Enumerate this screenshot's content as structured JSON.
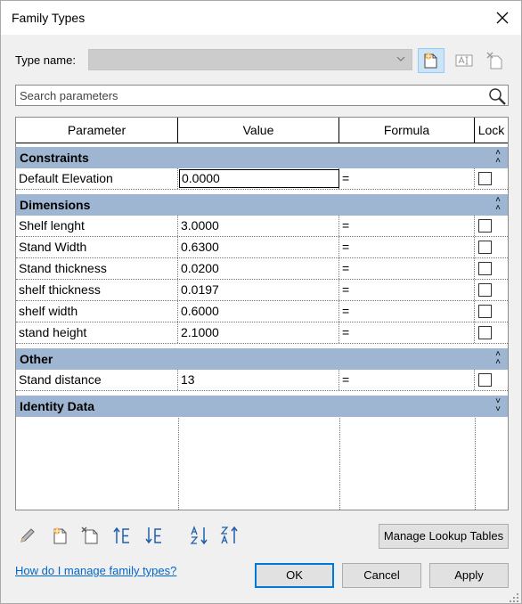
{
  "window": {
    "title": "Family Types"
  },
  "type_name": {
    "label": "Type name:",
    "value": ""
  },
  "search": {
    "placeholder": "Search parameters"
  },
  "table": {
    "headers": {
      "parameter": "Parameter",
      "value": "Value",
      "formula": "Formula",
      "lock": "Lock"
    },
    "groups": [
      {
        "title": "Constraints",
        "rows": [
          {
            "parameter": "Default Elevation",
            "value": "0.0000",
            "formula": "=",
            "locked": false
          }
        ]
      },
      {
        "title": "Dimensions",
        "rows": [
          {
            "parameter": "Shelf lenght",
            "value": "3.0000",
            "formula": "=",
            "locked": false
          },
          {
            "parameter": "Stand Width",
            "value": "0.6300",
            "formula": "=",
            "locked": false
          },
          {
            "parameter": "Stand thickness",
            "value": "0.0200",
            "formula": "=",
            "locked": false
          },
          {
            "parameter": "shelf thickness",
            "value": "0.0197",
            "formula": "=",
            "locked": false
          },
          {
            "parameter": "shelf width",
            "value": "0.6000",
            "formula": "=",
            "locked": false
          },
          {
            "parameter": "stand height",
            "value": "2.1000",
            "formula": "=",
            "locked": false
          }
        ]
      },
      {
        "title": "Other",
        "rows": [
          {
            "parameter": "Stand distance",
            "value": "13",
            "formula": "=",
            "locked": false
          }
        ]
      },
      {
        "title": "Identity Data",
        "rows": []
      }
    ]
  },
  "buttons": {
    "manage_lookup": "Manage Lookup Tables",
    "ok": "OK",
    "cancel": "Cancel",
    "apply": "Apply"
  },
  "help_link": "How do I manage family types?",
  "icons": {
    "toolbar": [
      "new-type-icon",
      "rename-type-icon",
      "delete-type-icon"
    ],
    "bottom": [
      "edit-parameter-icon",
      "new-parameter-icon",
      "delete-parameter-icon",
      "move-up-icon",
      "move-down-icon",
      "sort-ascending-icon",
      "sort-descending-icon"
    ]
  },
  "colors": {
    "group_header": "#9eb6d1",
    "link": "#0066cc",
    "default_button_border": "#0078d7",
    "active_tool": "#cce4f7"
  }
}
